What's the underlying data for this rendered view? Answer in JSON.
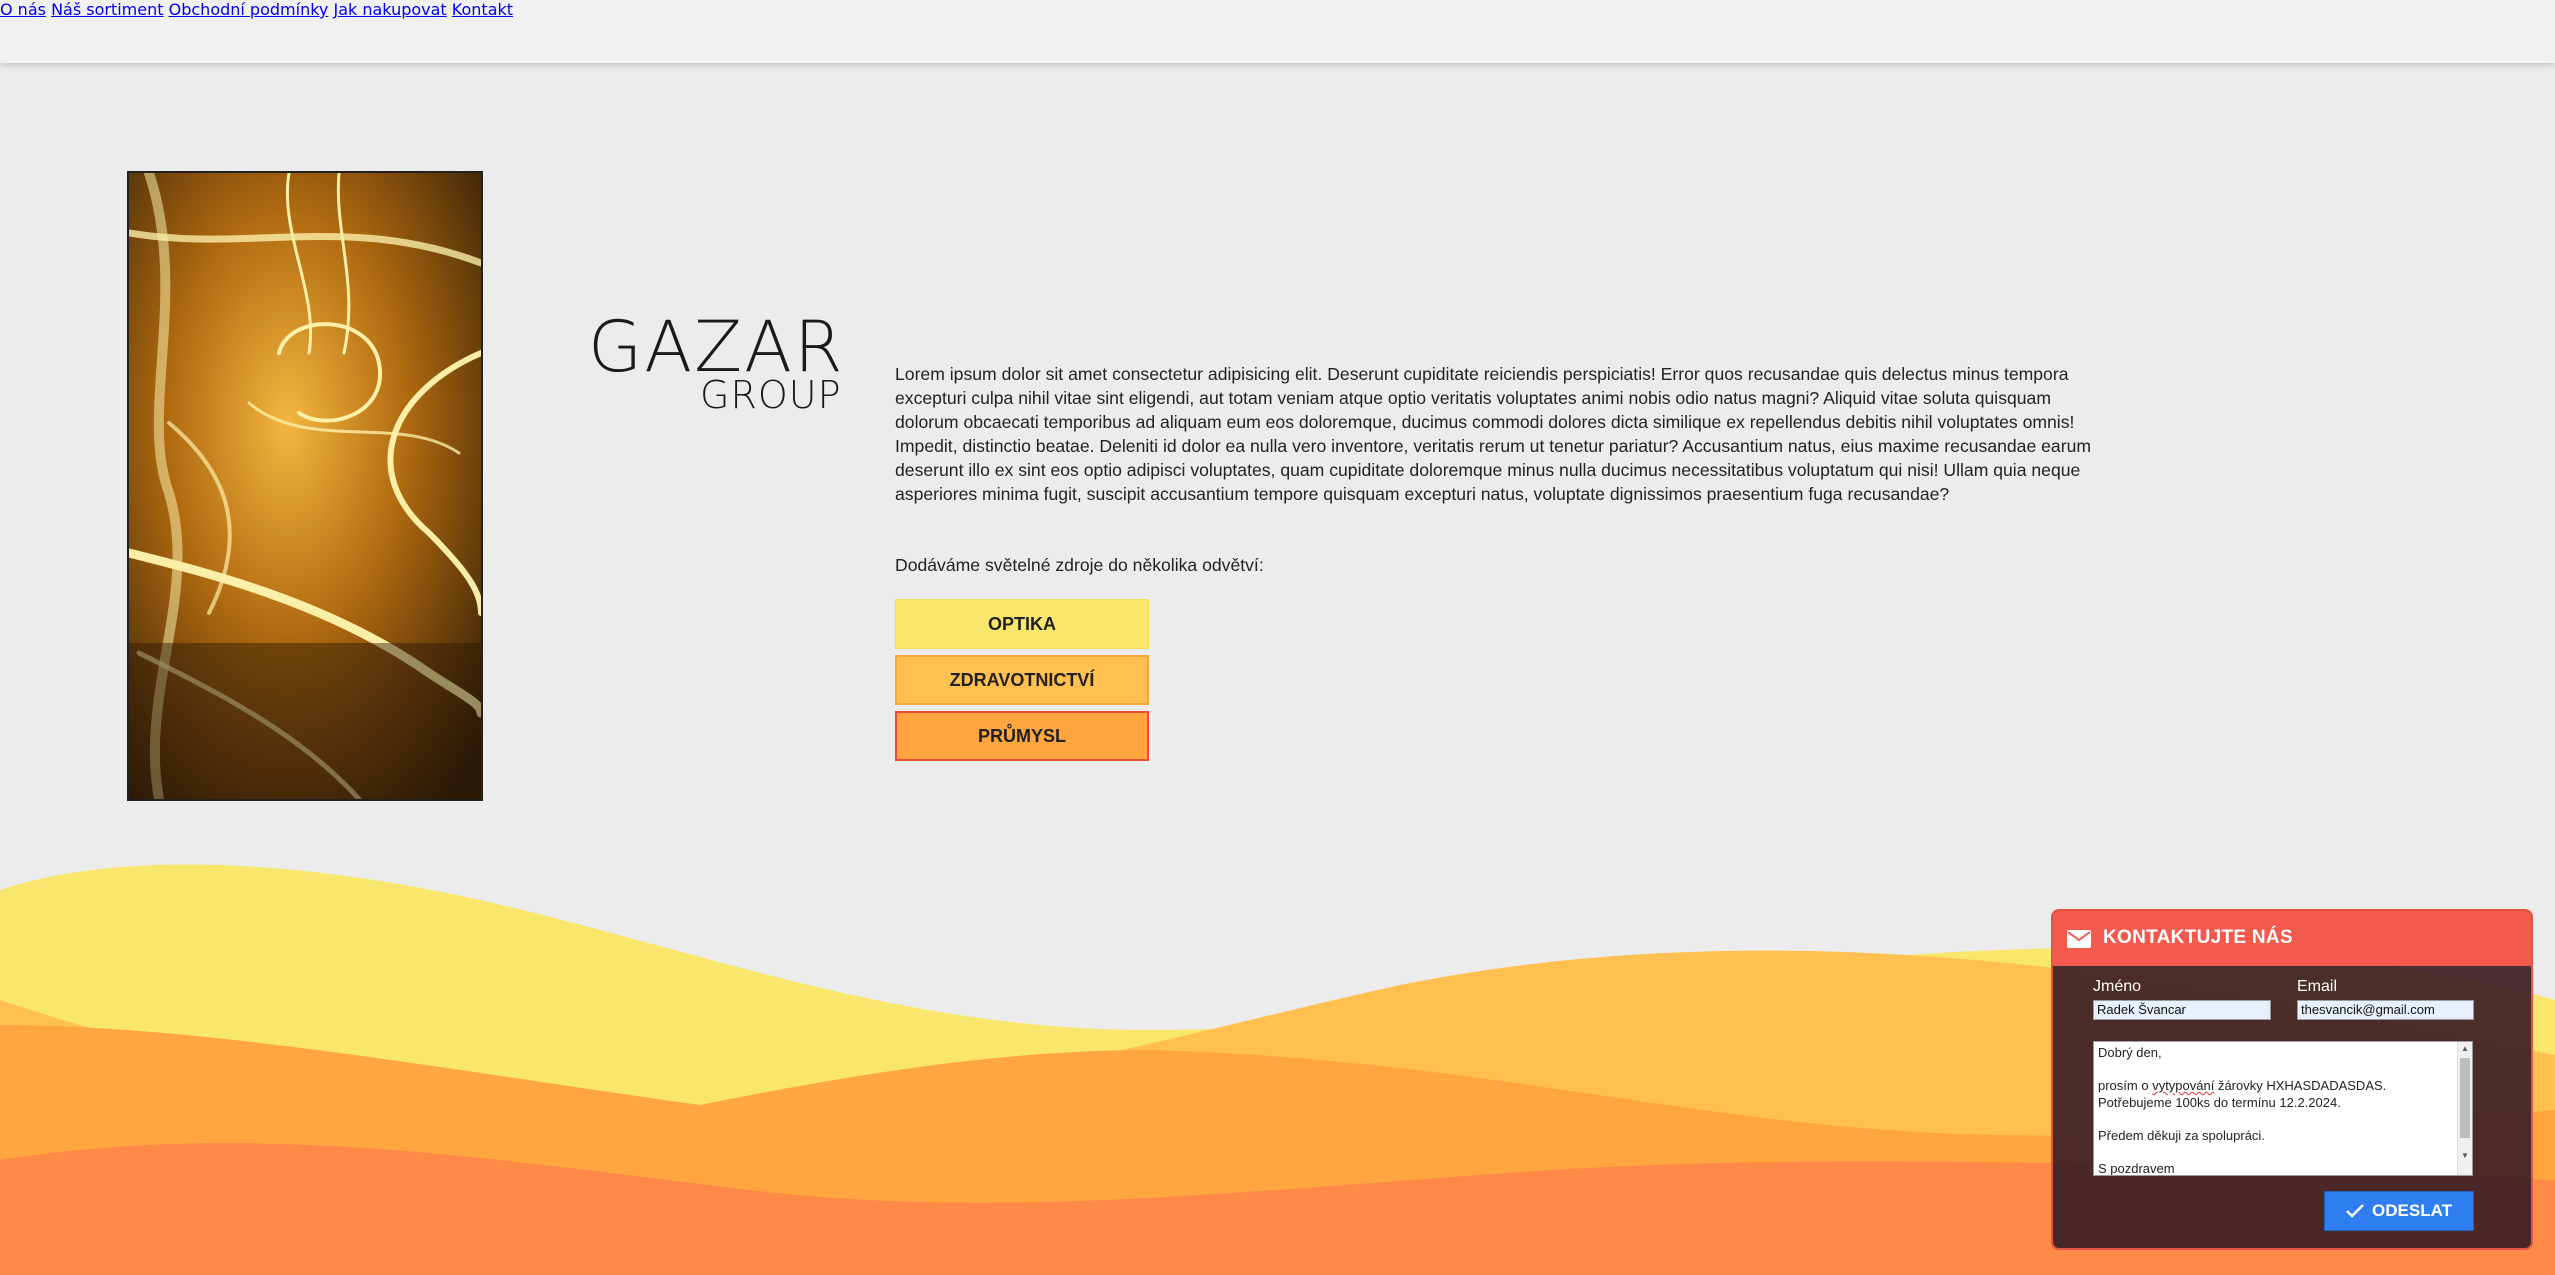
{
  "nav": {
    "items": [
      {
        "label": "O nás"
      },
      {
        "label": "Náš sortiment"
      },
      {
        "label": "Obchodní podmínky"
      },
      {
        "label": "Jak nakupovat"
      },
      {
        "label": "Kontakt"
      }
    ]
  },
  "hero": {
    "image_icon": "light-filament-photo",
    "logo": {
      "main": "GAZAR",
      "sub": "GROUP"
    },
    "lorem": "Lorem ipsum dolor sit amet consectetur adipisicing elit. Deserunt cupiditate reiciendis perspiciatis! Error quos recusandae quis delectus minus tempora excepturi culpa nihil vitae sint eligendi, aut totam veniam atque optio veritatis voluptates animi nobis odio natus magni? Aliquid vitae soluta quisquam dolorum obcaecati temporibus ad aliquam eum eos doloremque, ducimus commodi dolores dicta similique ex repellendus debitis nihil voluptates omnis! Impedit, distinctio beatae. Deleniti id dolor ea nulla vero inventore, veritatis rerum ut tenetur pariatur? Accusantium natus, eius maxime recusandae earum deserunt illo ex sint eos optio adipisci voluptates, quam cupiditate doloremque minus nulla ducimus necessitatibus voluptatum qui nisi! Ullam quia neque asperiores minima fugit, suscipit accusantium tempore quisquam excepturi natus, voluptate dignissimos praesentium fuga recusandae?",
    "intro": "Dodáváme světelné zdroje do několika odvětví:",
    "categories": [
      {
        "label": "OPTIKA",
        "color": "#f9e66c"
      },
      {
        "label": "ZDRAVOTNICTVÍ",
        "color": "#ffc04f"
      },
      {
        "label": "PRŮMYSL",
        "color": "#ffa640"
      }
    ]
  },
  "contact": {
    "title": "KONTAKTUJTE NÁS",
    "header_color": "#f15a4c",
    "name_label": "Jméno",
    "name_value": "Radek Švancar",
    "email_label": "Email",
    "email_value": "thesvancik@gmail.com",
    "message": {
      "line1": "Dobrý den,",
      "line2a": "prosím o ",
      "line2b": "vytypování",
      "line2c": " žárovky HXHASDADASDAS.",
      "line3": "Potřebujeme 100ks do termínu 12.2.2024.",
      "line4": "Předem děkuji za spolupráci.",
      "line5": "S pozdravem"
    },
    "send_label": "ODESLAT",
    "send_color": "#2f7ff2"
  },
  "colors": {
    "wave_yellow": "#f9e66c",
    "wave_light_orange": "#ffc04f",
    "wave_orange": "#ffa640",
    "wave_deep_orange": "#ff8a48"
  }
}
